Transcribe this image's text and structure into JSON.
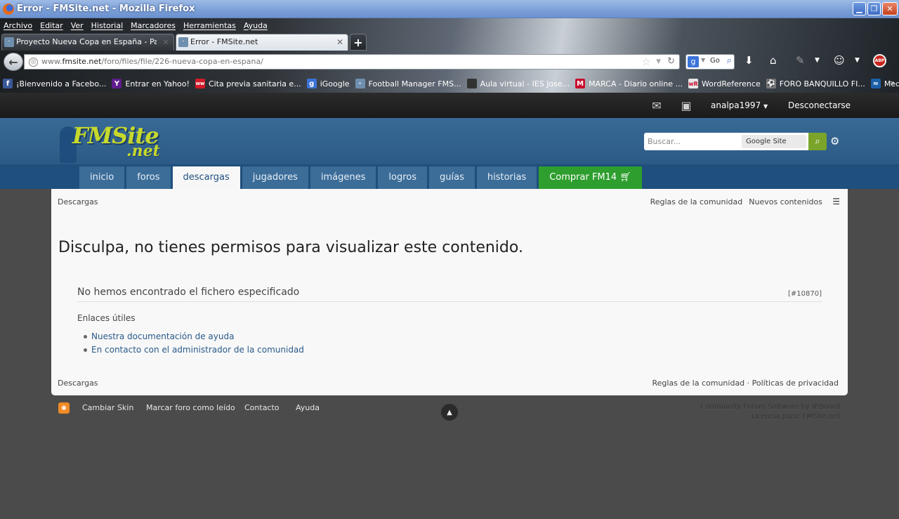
{
  "window": {
    "title": "Error - FMSite.net - Mozilla Firefox",
    "minimize": "▁",
    "restore": "❐",
    "close": "✕"
  },
  "menu": [
    "Archivo",
    "Editar",
    "Ver",
    "Historial",
    "Marcadores",
    "Herramientas",
    "Ayuda"
  ],
  "tabs": [
    {
      "label": "Proyecto Nueva Copa en España - Pagin...",
      "close": "✕"
    },
    {
      "label": "Error - FMSite.net",
      "close": "✕"
    }
  ],
  "new_tab": "+",
  "url": {
    "prefix": "www.",
    "domain": "fmsite.net",
    "path": "/foro/files/file/226-nueva-copa-en-espana/"
  },
  "search": {
    "engine_label": "Go"
  },
  "bookmarks": [
    {
      "label": "¡Bienvenido a Facebo...",
      "icon": "facebook-icon",
      "glyph": "f",
      "color": "#3b5998"
    },
    {
      "label": "Entrar en Yahoo!",
      "icon": "yahoo-icon",
      "glyph": "Y",
      "color": "#5f1c8d"
    },
    {
      "label": "Cita previa sanitaria e...",
      "icon": "health-icon",
      "glyph": "ww",
      "color": "#d11a2a"
    },
    {
      "label": "iGoogle",
      "icon": "google-icon",
      "glyph": "g",
      "color": "#3b73d9"
    },
    {
      "label": "Football Manager FMS...",
      "icon": "fmsite-icon",
      "glyph": "·",
      "color": "#6f8fae"
    },
    {
      "label": "Aula virtual - IES Jose...",
      "icon": "moodle-icon",
      "glyph": "",
      "color": "#333333"
    },
    {
      "label": "MARCA - Diario online ...",
      "icon": "marca-icon",
      "glyph": "M",
      "color": "#c8102e"
    },
    {
      "label": "WordReference",
      "icon": "wordreference-icon",
      "glyph": "wR",
      "color": "#e8e8e8"
    },
    {
      "label": "FORO BANQUILLO FI...",
      "icon": "forum-icon",
      "glyph": "⚽",
      "color": "#777777"
    },
    {
      "label": "MediaFire",
      "icon": "mediafire-icon",
      "glyph": "≈",
      "color": "#1b5fa8"
    }
  ],
  "userbar": {
    "username": "analpa1997",
    "logout": "Desconectarse"
  },
  "site": {
    "logo_main": "FMSite",
    "logo_sub": ".net",
    "search_placeholder": "Buscar...",
    "search_scope": "Google Site",
    "nav": [
      "inicio",
      "foros",
      "descargas",
      "jugadores",
      "imágenes",
      "logros",
      "guías",
      "historias",
      "Comprar FM14"
    ],
    "nav_active": "descargas"
  },
  "content": {
    "breadcrumb": "Descargas",
    "top_links": [
      "Reglas de la comunidad",
      "Nuevos contenidos"
    ],
    "heading": "Disculpa, no tienes permisos para visualizar este contenido.",
    "message": "No hemos encontrado el fichero especificado",
    "error_code": "[#10870]",
    "useful_title": "Enlaces útiles",
    "useful_links": [
      "Nuestra documentación de ayuda",
      "En contacto con el administrador de la comunidad"
    ],
    "footer_breadcrumb": "Descargas",
    "footer_links": "Reglas de la comunidad · Políticas de privacidad"
  },
  "footer": {
    "links": [
      "Cambiar Skin",
      "Marcar foro como leído",
      "Contacto",
      "Ayuda"
    ],
    "copyright_1": "Community Forum Software by IP.Board",
    "copyright_2": "Licencia para: FMSite.net"
  },
  "colors": {
    "accent": "#1f4f7c",
    "buy_button": "#2e9e2e",
    "link": "#2a5a8a"
  }
}
